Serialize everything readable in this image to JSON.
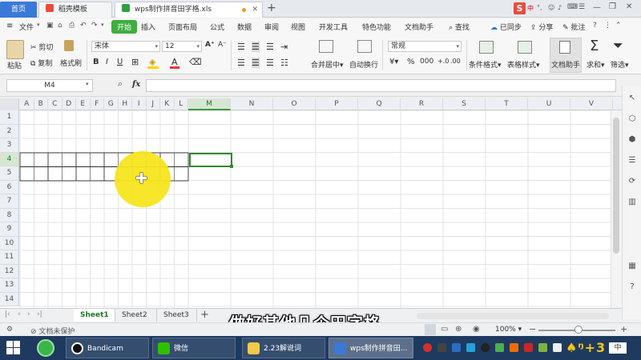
{
  "tabs": {
    "home": "首页",
    "template": "稻壳模板",
    "file": "wps制作拼音田字格.xls"
  },
  "top_right": {
    "logo": "S"
  },
  "menu": [
    "文件",
    "开始",
    "插入",
    "页面布局",
    "公式",
    "数据",
    "审阅",
    "视图",
    "开发工具",
    "特色功能",
    "文档助手"
  ],
  "menu_right": {
    "search": "查找",
    "sync": "已同步",
    "share": "分享",
    "comment": "批注"
  },
  "ribbon": {
    "paste": "粘贴",
    "cut": "剪切",
    "copy": "复制",
    "format_painter": "格式刷",
    "font_name": "宋体",
    "font_size": "12",
    "merge_center": "合并居中",
    "wrap_text": "自动换行",
    "number_format": "常规",
    "cond_format": "条件格式",
    "table_style": "表格样式",
    "doc_helper": "文档助手",
    "sum": "求和",
    "filter": "筛选"
  },
  "formula_bar": {
    "name_box": "M4",
    "fx": "fx",
    "value": ""
  },
  "columns": [
    "A",
    "B",
    "C",
    "D",
    "E",
    "F",
    "G",
    "H",
    "I",
    "J",
    "K",
    "L",
    "M",
    "N",
    "O",
    "P",
    "Q",
    "R",
    "S",
    "T",
    "U",
    "V"
  ],
  "selected_column": "M",
  "rows": [
    "1",
    "2",
    "3",
    "4",
    "5",
    "6",
    "7",
    "8",
    "9",
    "10",
    "11",
    "12",
    "13",
    "14"
  ],
  "selected_row": "4",
  "sheet_tabs": [
    "Sheet1",
    "Sheet2",
    "Sheet3"
  ],
  "active_sheet": "Sheet1",
  "status": {
    "doc_unprotected": "文档未保护",
    "zoom": "100%"
  },
  "taskbar": {
    "items": [
      "Bandicam",
      "微信",
      "2.23解说词",
      "wps制作拼音田..."
    ]
  },
  "subtitle": "做好其他几个田字格",
  "colors": {
    "accent_green": "#3fae3f",
    "home_blue": "#3a79d8",
    "cursor_highlight": "#f7e51e",
    "taskbar": "#1f3a5f"
  }
}
